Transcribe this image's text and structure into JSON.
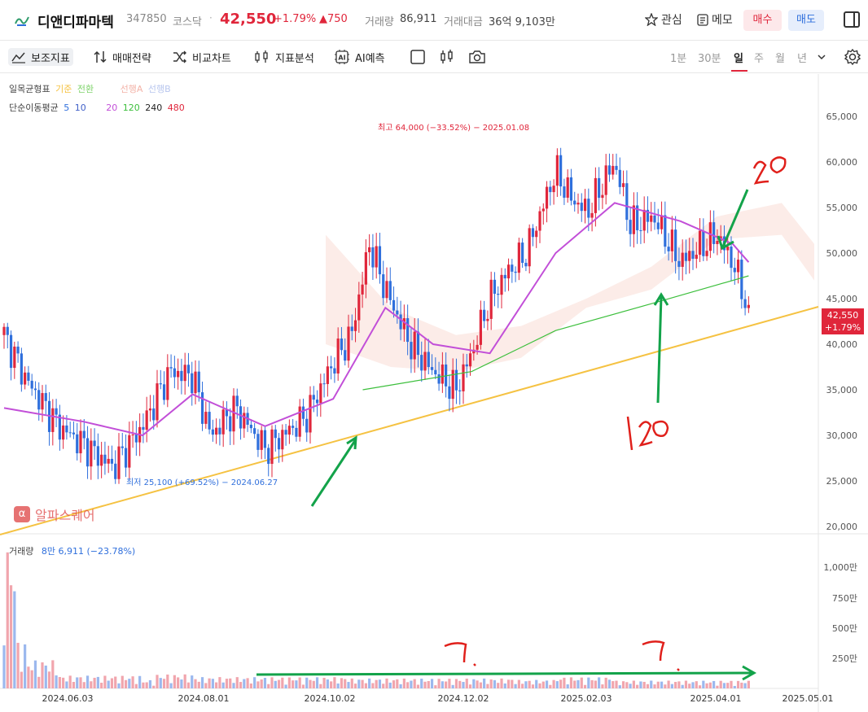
{
  "header": {
    "name": "디앤디파마텍",
    "code": "347850",
    "market": "코스닥",
    "price": "42,550",
    "change_pct": "+1.79%",
    "change_abs": "▲750",
    "volume_label": "거래량",
    "volume_value": "86,911",
    "amount_label": "거래대금",
    "amount_value": "36억 9,103만",
    "fav_label": "관심",
    "memo_label": "메모",
    "buy_label": "매수",
    "sell_label": "매도"
  },
  "toolbar": {
    "indicators": "보조지표",
    "strategy": "매매전략",
    "compare": "비교차트",
    "analysis": "지표분석",
    "ai": "AI예측",
    "periods": [
      "1분",
      "30분",
      "일",
      "주",
      "월",
      "년"
    ],
    "active_period": "일"
  },
  "legend": {
    "ichimoku_label": "일목균형표",
    "ichimoku_items": [
      {
        "label": "기준",
        "color": "#f5c242"
      },
      {
        "label": "전환",
        "color": "#7fd36b"
      },
      {
        "label": "선행A",
        "color": "#f3b3a8"
      },
      {
        "label": "선행B",
        "color": "#b8c6ee"
      }
    ],
    "ma_label": "단순이동평균",
    "ma_items": [
      {
        "label": "5",
        "color": "#2f6fdc"
      },
      {
        "label": "10",
        "color": "#4060c8"
      },
      {
        "label": "20",
        "color": "#c24fd8"
      },
      {
        "label": "120",
        "color": "#3cbf3c"
      },
      {
        "label": "240",
        "color": "#222222"
      },
      {
        "label": "480",
        "color": "#e0263b"
      }
    ]
  },
  "annotations": {
    "high": "최고 64,000 (−33.52%) − 2025.01.08",
    "low": "최저 25,100 (+69.52%) − 2024.06.27",
    "watermark": "알파스퀘어",
    "watermark_icon": "α"
  },
  "price_tag": {
    "price": "42,550",
    "pct": "+1.79%"
  },
  "volume_legend": {
    "label": "거래량",
    "value": "8만 6,911 (−23.78%)"
  },
  "chart_data": {
    "type": "candlestick",
    "y_ticks": [
      "65,000",
      "60,000",
      "55,000",
      "50,000",
      "45,000",
      "40,000",
      "35,000",
      "30,000",
      "25,000",
      "20,000"
    ],
    "ylim": [
      20000,
      65000
    ],
    "volume_ticks": [
      "1,000만",
      "750만",
      "500만",
      "250만"
    ],
    "x_ticks": [
      "2024.06.03",
      "2024.08.01",
      "2024.10.02",
      "2024.12.02",
      "2025.02.03",
      "2025.04.01",
      "2025.05.01"
    ],
    "close_path": [
      {
        "date": "2024.05.10",
        "value": 41000
      },
      {
        "date": "2024.05.20",
        "value": 36000
      },
      {
        "date": "2024.06.03",
        "value": 31000
      },
      {
        "date": "2024.06.14",
        "value": 29000
      },
      {
        "date": "2024.06.27",
        "value": 26500
      },
      {
        "date": "2024.07.10",
        "value": 31000
      },
      {
        "date": "2024.07.22",
        "value": 37000
      },
      {
        "date": "2024.08.01",
        "value": 36500
      },
      {
        "date": "2024.08.09",
        "value": 30000
      },
      {
        "date": "2024.08.20",
        "value": 33000
      },
      {
        "date": "2024.09.02",
        "value": 28500
      },
      {
        "date": "2024.09.20",
        "value": 32000
      },
      {
        "date": "2024.10.02",
        "value": 38000
      },
      {
        "date": "2024.10.10",
        "value": 41000
      },
      {
        "date": "2024.10.18",
        "value": 51000
      },
      {
        "date": "2024.10.25",
        "value": 46000
      },
      {
        "date": "2024.11.05",
        "value": 40000
      },
      {
        "date": "2024.11.15",
        "value": 37000
      },
      {
        "date": "2024.11.25",
        "value": 35000
      },
      {
        "date": "2024.12.02",
        "value": 39000
      },
      {
        "date": "2024.12.10",
        "value": 45000
      },
      {
        "date": "2024.12.18",
        "value": 48000
      },
      {
        "date": "2024.12.26",
        "value": 50000
      },
      {
        "date": "2025.01.08",
        "value": 59000
      },
      {
        "date": "2025.01.15",
        "value": 56000
      },
      {
        "date": "2025.01.22",
        "value": 54500
      },
      {
        "date": "2025.02.03",
        "value": 60000
      },
      {
        "date": "2025.02.10",
        "value": 53000
      },
      {
        "date": "2025.02.20",
        "value": 54000
      },
      {
        "date": "2025.03.04",
        "value": 49000
      },
      {
        "date": "2025.03.12",
        "value": 50500
      },
      {
        "date": "2025.03.20",
        "value": 52000
      },
      {
        "date": "2025.03.27",
        "value": 49000
      },
      {
        "date": "2025.04.01",
        "value": 45500
      },
      {
        "date": "2025.04.03",
        "value": 42550
      }
    ],
    "ma20": [
      {
        "date": "2024.05.10",
        "value": 33000
      },
      {
        "date": "2024.06.14",
        "value": 31500
      },
      {
        "date": "2024.07.10",
        "value": 30000
      },
      {
        "date": "2024.08.01",
        "value": 34500
      },
      {
        "date": "2024.09.02",
        "value": 31000
      },
      {
        "date": "2024.10.02",
        "value": 34000
      },
      {
        "date": "2024.10.25",
        "value": 44000
      },
      {
        "date": "2024.11.15",
        "value": 40000
      },
      {
        "date": "2024.12.10",
        "value": 39000
      },
      {
        "date": "2025.01.08",
        "value": 50000
      },
      {
        "date": "2025.02.03",
        "value": 55500
      },
      {
        "date": "2025.03.04",
        "value": 53500
      },
      {
        "date": "2025.03.27",
        "value": 51000
      },
      {
        "date": "2025.04.03",
        "value": 49000
      }
    ],
    "ma120": [
      {
        "date": "2024.10.15",
        "value": 35000
      },
      {
        "date": "2024.12.02",
        "value": 37000
      },
      {
        "date": "2025.01.08",
        "value": 41500
      },
      {
        "date": "2025.02.20",
        "value": 44500
      },
      {
        "date": "2025.03.20",
        "value": 46500
      },
      {
        "date": "2025.04.03",
        "value": 47500
      }
    ],
    "volume": [
      {
        "date": "2024.05.10",
        "value": 1000,
        "up": true
      },
      {
        "date": "2024.05.15",
        "value": 330,
        "up": false
      },
      {
        "date": "2024.05.20",
        "value": 200,
        "up": true
      },
      {
        "date": "2024.06.03",
        "value": 90,
        "up": false
      },
      {
        "date": "2024.07.10",
        "value": 60,
        "up": true
      },
      {
        "date": "2024.07.15",
        "value": 100,
        "up": true
      },
      {
        "date": "2024.08.01",
        "value": 80,
        "up": true
      },
      {
        "date": "2024.10.10",
        "value": 70,
        "up": true
      },
      {
        "date": "2024.12.20",
        "value": 60,
        "up": false
      },
      {
        "date": "2025.01.08",
        "value": 80,
        "up": true
      },
      {
        "date": "2025.02.03",
        "value": 55,
        "up": true
      },
      {
        "date": "2025.03.20",
        "value": 50,
        "up": false
      }
    ],
    "up_color": "#e0263b",
    "down_color": "#2f6fdc"
  }
}
